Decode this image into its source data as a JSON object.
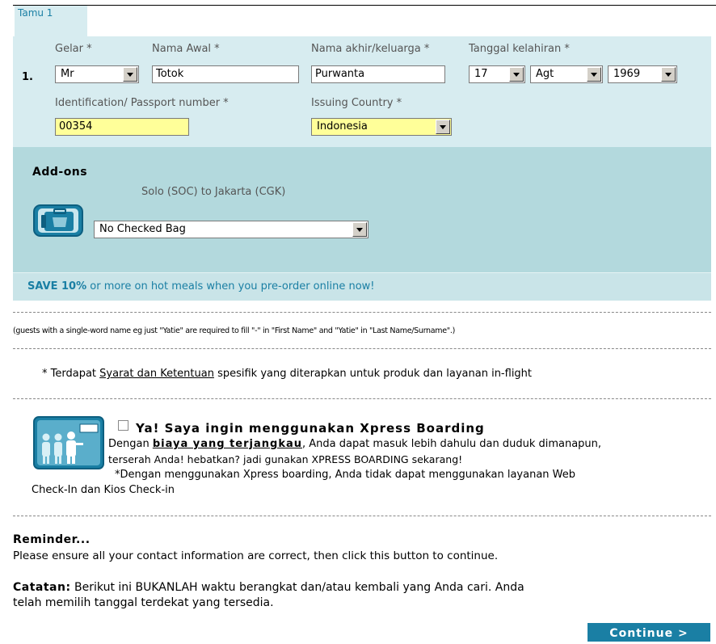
{
  "tab_label": "Tamu 1",
  "guest": {
    "number": "1.",
    "title_label": "Gelar *",
    "title_value": "Mr",
    "first_name_label": "Nama Awal *",
    "first_name_value": "Totok",
    "last_name_label": "Nama akhir/keluarga *",
    "last_name_value": "Purwanta",
    "dob_label": "Tanggal kelahiran *",
    "dob_day": "17",
    "dob_month": "Agt",
    "dob_year": "1969",
    "id_label": "Identification/ Passport number *",
    "id_value": "00354",
    "country_label": "Issuing Country *",
    "country_value": "Indonesia"
  },
  "addons": {
    "heading": "Add-ons",
    "route": "Solo (SOC) to Jakarta (CGK)",
    "baggage_value": "No Checked Bag"
  },
  "save_bar": {
    "bold": "SAVE 10%",
    "rest": " or more on hot meals when you pre-order online now!"
  },
  "name_note": "(guests with a single-word name eg just \"Yatie\" are required to fill \"-\" in \"First Name\" and \"Yatie\" in \"Last Name/Surname\".)",
  "terms": {
    "prefix": "* Terdapat ",
    "link": "Syarat dan Ketentuan",
    "suffix": " spesifik yang diterapkan untuk produk dan layanan in-flight"
  },
  "xpress": {
    "title": "Ya! Saya ingin menggunakan Xpress Boarding",
    "line1_prefix": "Dengan ",
    "line1_link": "biaya yang terjangkau",
    "line1_suffix": ", Anda dapat masuk lebih dahulu dan duduk dimanapun,",
    "line2": "terserah Anda! hebatkan? jadi gunakan XPRESS BOARDING sekarang!",
    "line3": "*Dengan menggunakan Xpress boarding, Anda tidak dapat menggunakan layanan Web",
    "line4": "Check-In dan Kios Check-in"
  },
  "reminder": {
    "heading": "Reminder...",
    "text": "Please ensure all your contact information are correct, then click this button to continue."
  },
  "catatan": {
    "label": "Catatan:",
    "line1": " Berikut ini BUKANLAH waktu berangkat dan/atau kembali yang Anda cari. Anda",
    "line2": "telah memilih tanggal terdekat yang tersedia."
  },
  "continue_label": "Continue >",
  "colors": {
    "accent": "#1a7fa4",
    "panel_light": "#d7ecf0",
    "panel_mid": "#b3d9dd",
    "highlight_input": "#ffff99"
  }
}
